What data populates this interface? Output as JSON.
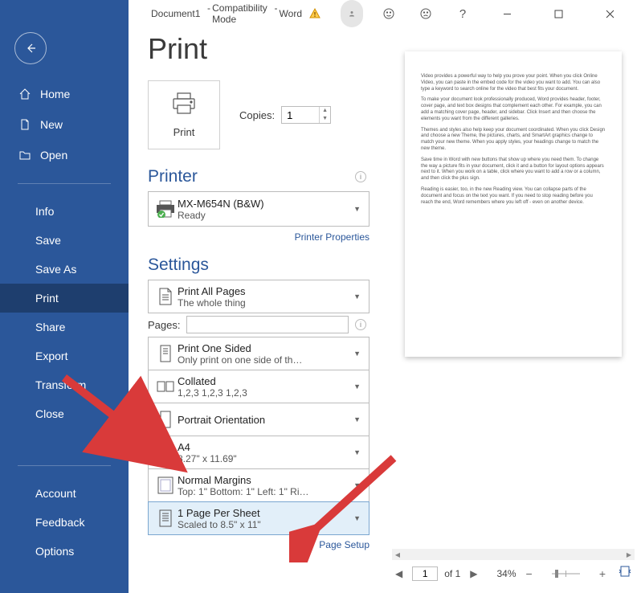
{
  "titlebar": {
    "doc": "Document1",
    "mode": "Compatibility Mode",
    "app": "Word"
  },
  "sidebar": {
    "home_label": "Home",
    "new_label": "New",
    "open_label": "Open",
    "info_label": "Info",
    "save_label": "Save",
    "saveas_label": "Save As",
    "print_label": "Print",
    "share_label": "Share",
    "export_label": "Export",
    "transform_label": "Transform",
    "close_label": "Close",
    "account_label": "Account",
    "feedback_label": "Feedback",
    "options_label": "Options"
  },
  "print": {
    "title": "Print",
    "button": "Print",
    "copies_label": "Copies:",
    "copies_value": "1"
  },
  "printer": {
    "section": "Printer",
    "name": "MX-M654N (B&W)",
    "status": "Ready",
    "properties": "Printer Properties"
  },
  "settings": {
    "section": "Settings",
    "print_pages_main": "Print All Pages",
    "print_pages_sub": "The whole thing",
    "pages_label": "Pages:",
    "sided_main": "Print One Sided",
    "sided_sub": "Only print on one side of th…",
    "collated_main": "Collated",
    "collated_sub": "1,2,3    1,2,3    1,2,3",
    "orientation_main": "Portrait Orientation",
    "paper_main": "A4",
    "paper_sub": "8.27\" x 11.69\"",
    "margins_main": "Normal Margins",
    "margins_sub": "Top: 1\" Bottom: 1\" Left: 1\" Ri…",
    "persheet_main": "1 Page Per Sheet",
    "persheet_sub": "Scaled to 8.5\" x 11\"",
    "page_setup": "Page Setup"
  },
  "preview": {
    "p1": "Video provides a powerful way to help you prove your point. When you click Online Video, you can paste in the embed code for the video you want to add. You can also type a keyword to search online for the video that best fits your document.",
    "p2": "To make your document look professionally produced, Word provides header, footer, cover page, and text box designs that complement each other. For example, you can add a matching cover page, header, and sidebar. Click Insert and then choose the elements you want from the different galleries.",
    "p3": "Themes and styles also help keep your document coordinated. When you click Design and choose a new Theme, the pictures, charts, and SmartArt graphics change to match your new theme. When you apply styles, your headings change to match the new theme.",
    "p4": "Save time in Word with new buttons that show up where you need them. To change the way a picture fits in your document, click it and a button for layout options appears next to it. When you work on a table, click where you want to add a row or a column, and then click the plus sign.",
    "p5": "Reading is easier, too, in the new Reading view. You can collapse parts of the document and focus on the text you want. If you need to stop reading before you reach the end, Word remembers where you left off - even on another device."
  },
  "footer": {
    "page_value": "1",
    "of_text": "of 1",
    "zoom_pct": "34%"
  }
}
